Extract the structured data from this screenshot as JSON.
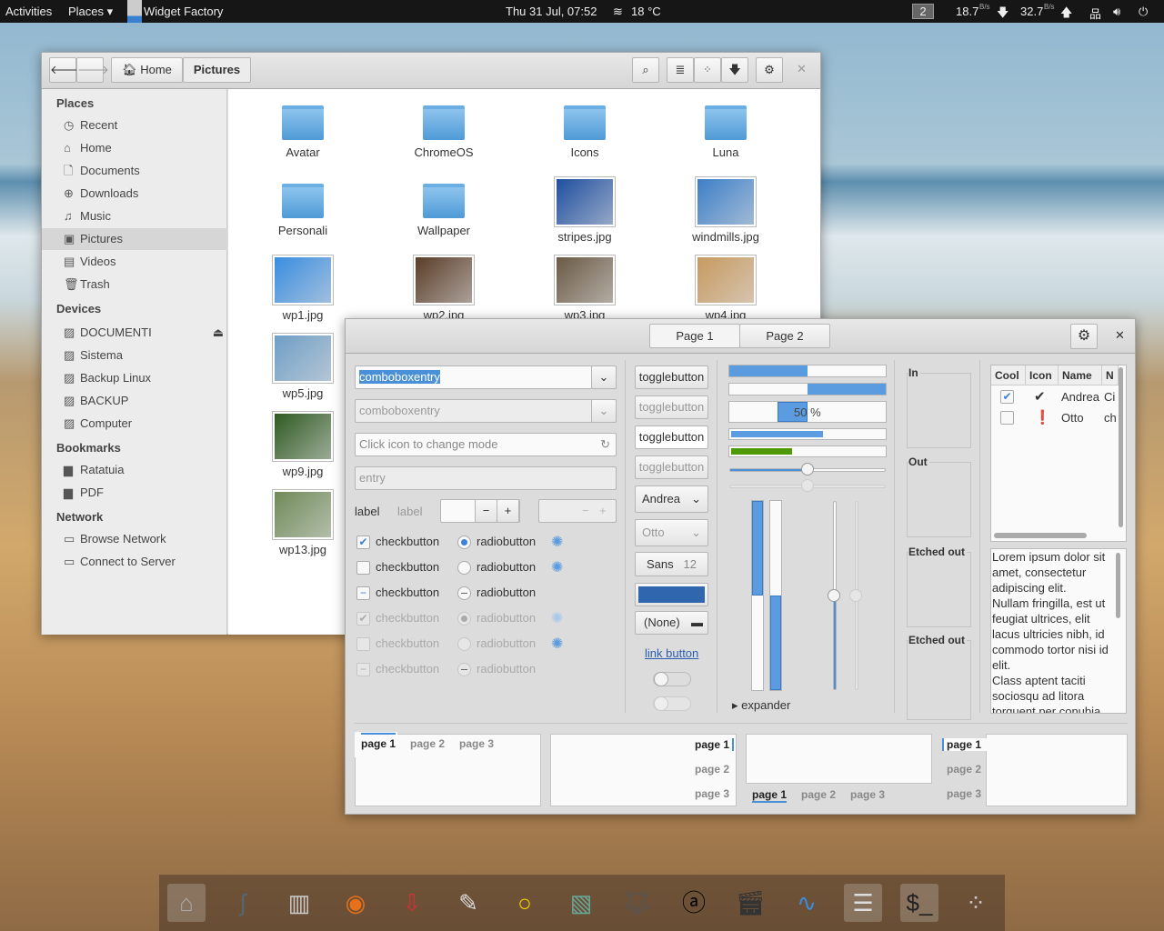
{
  "topbar": {
    "activities": "Activities",
    "places": "Places",
    "app": "Widget Factory",
    "clock": "Thu 31 Jul, 07:52",
    "weather": "18 °C",
    "workspace": "2",
    "down_speed": "18.7",
    "up_speed": "32.7",
    "speed_unit": "B/s"
  },
  "files": {
    "back": "back",
    "forward": "forward",
    "path": [
      "Home",
      "Pictures"
    ],
    "sidebar": {
      "places_header": "Places",
      "places": [
        "Recent",
        "Home",
        "Documents",
        "Downloads",
        "Music",
        "Pictures",
        "Videos",
        "Trash"
      ],
      "devices_header": "Devices",
      "devices": [
        "DOCUMENTI",
        "Sistema",
        "Backup Linux",
        "BACKUP",
        "Computer"
      ],
      "bookmarks_header": "Bookmarks",
      "bookmarks": [
        "Ratatuia",
        "PDF"
      ],
      "network_header": "Network",
      "network": [
        "Browse Network",
        "Connect to Server"
      ]
    },
    "items": [
      {
        "name": "Avatar",
        "type": "folder"
      },
      {
        "name": "ChromeOS",
        "type": "folder"
      },
      {
        "name": "Icons",
        "type": "folder"
      },
      {
        "name": "Luna",
        "type": "folder"
      },
      {
        "name": "Personali",
        "type": "folder"
      },
      {
        "name": "Wallpaper",
        "type": "folder"
      },
      {
        "name": "stripes.jpg",
        "type": "image",
        "color": "#1f4fa0"
      },
      {
        "name": "windmills.jpg",
        "type": "image",
        "color": "#3d7fc8"
      },
      {
        "name": "wp1.jpg",
        "type": "image",
        "color": "#3a8de0"
      },
      {
        "name": "wp2.jpg",
        "type": "image",
        "color": "#5a3d28"
      },
      {
        "name": "wp3.jpg",
        "type": "image",
        "color": "#6b5a45"
      },
      {
        "name": "wp4.jpg",
        "type": "image",
        "color": "#c79a60"
      },
      {
        "name": "wp5.jpg",
        "type": "image",
        "color": "#6f9ec6"
      },
      {
        "name": "wp9.jpg",
        "type": "image",
        "color": "#2f5a22"
      },
      {
        "name": "wp13.jpg",
        "type": "image",
        "color": "#6f8a58"
      }
    ]
  },
  "widget": {
    "tabs": [
      "Page 1",
      "Page 2"
    ],
    "combo1": "comboboxentry",
    "combo2": "comboboxentry",
    "entry_mode_placeholder": "Click icon to change mode",
    "entry_placeholder": "entry",
    "label1": "label",
    "label2": "label",
    "check": "checkbutton",
    "radio": "radiobutton",
    "toggle": "togglebutton",
    "combo_andrea": "Andrea",
    "combo_otto": "Otto",
    "font_name": "Sans",
    "font_size": "12",
    "file_none": "(None)",
    "link": "link button",
    "progress_label": "50 %",
    "progress": [
      0.5,
      0.5,
      0.5,
      0.6,
      0.4
    ],
    "hscale": 0.5,
    "vprogress": [
      0.5,
      0.5
    ],
    "vscale": 0.5,
    "expander": "expander",
    "frames": [
      "In",
      "Out",
      "Etched out",
      "Etched out"
    ],
    "tree": {
      "columns": [
        "Cool",
        "Icon",
        "Name",
        "N"
      ],
      "rows": [
        {
          "cool": true,
          "icon": "check-circle-icon",
          "name": "Andrea",
          "n": "Ci"
        },
        {
          "cool": false,
          "icon": "exclamation-circle-icon",
          "name": "Otto",
          "n": "ch"
        }
      ]
    },
    "text": "Lorem ipsum dolor sit amet, consectetur adipiscing elit.\nNullam fringilla, est ut feugiat ultrices, elit lacus ultricies nibh, id commodo tortor nisi id elit.\nClass aptent taciti sociosqu ad litora torquent per conubia",
    "nb_tabs": [
      "page 1",
      "page 2",
      "page 3"
    ]
  },
  "dock": [
    "Home folder",
    "Scanner",
    "Mixer",
    "Firefox",
    "Transmission",
    "Text editor",
    "Shutter",
    "Shotwell",
    "GIMP",
    "Amarok",
    "Clapper",
    "System monitor",
    "Widget Factory",
    "Terminal",
    "Show applications"
  ],
  "colors": {
    "accent": "#4a90d9",
    "green": "#4e9a06"
  }
}
